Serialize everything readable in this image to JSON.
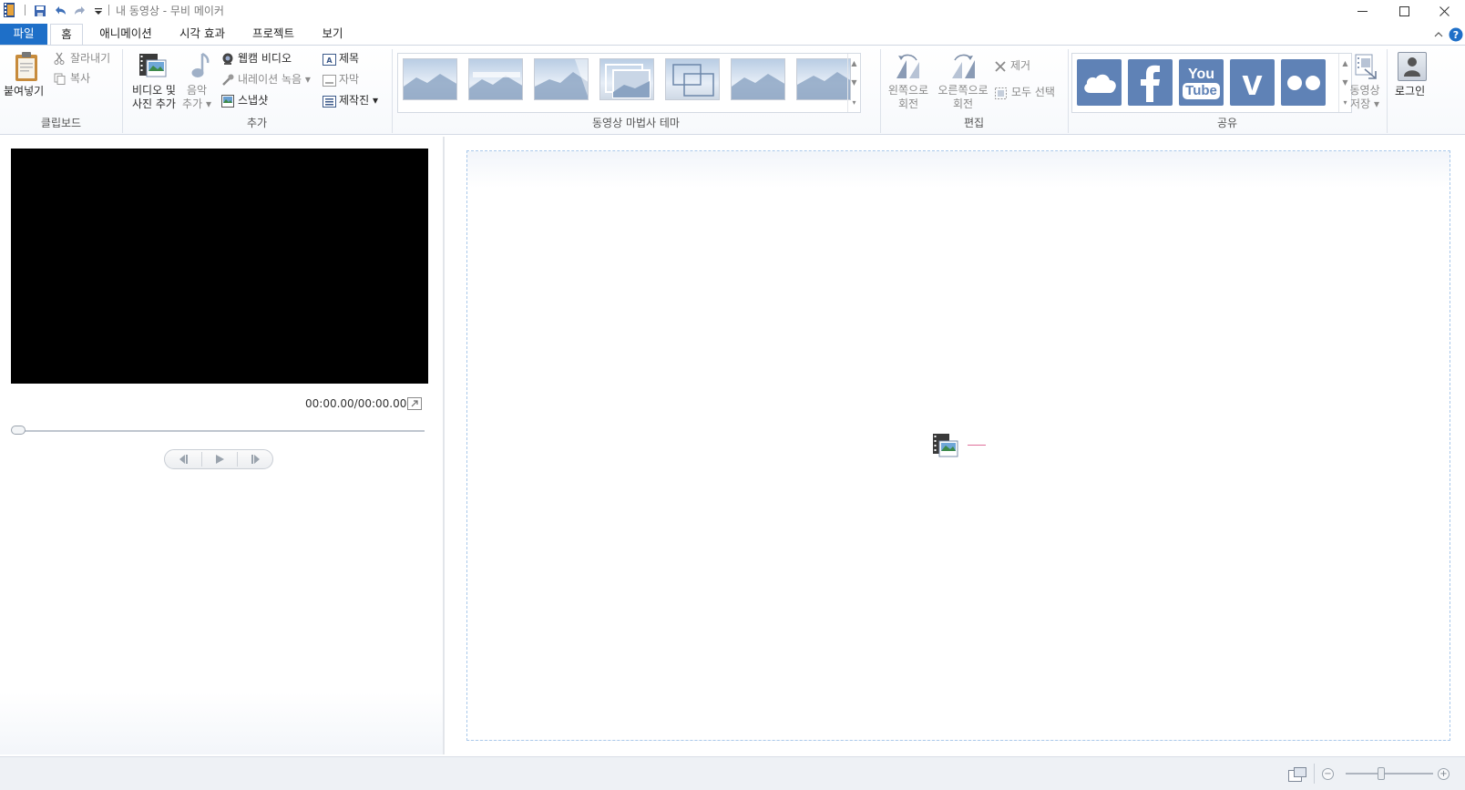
{
  "window": {
    "title": "내 동영상 - 무비 메이커"
  },
  "tabs": [
    {
      "label": "파일"
    },
    {
      "label": "홈"
    },
    {
      "label": "애니메이션"
    },
    {
      "label": "시각 효과"
    },
    {
      "label": "프로젝트"
    },
    {
      "label": "보기"
    }
  ],
  "ribbon": {
    "clipboard": {
      "paste": "붙여넣기",
      "cut": "잘라내기",
      "copy": "복사",
      "group": "클립보드"
    },
    "add": {
      "add_video_line1": "비디오 및",
      "add_video_line2": "사진 추가",
      "add_music_line1": "음악",
      "add_music_line2": "추가",
      "webcam": "웹캠 비디오",
      "narration": "내레이션 녹음",
      "snapshot": "스냅샷",
      "title": "제목",
      "caption": "자막",
      "credits": "제작진",
      "group": "추가"
    },
    "themes": {
      "group": "동영상 마법사 테마"
    },
    "edit": {
      "rotate_left_line1": "왼쪽으로",
      "rotate_left_line2": "회전",
      "rotate_right_line1": "오른쪽으로",
      "rotate_right_line2": "회전",
      "remove": "제거",
      "select_all": "모두 선택",
      "group": "편집"
    },
    "share": {
      "items": [
        {
          "icon": "onedrive-icon"
        },
        {
          "icon": "facebook-icon"
        },
        {
          "icon": "youtube-icon",
          "line1": "You",
          "line2": "Tube"
        },
        {
          "icon": "vimeo-icon",
          "text": "v"
        },
        {
          "icon": "flickr-icon"
        }
      ],
      "save_line1": "동영상",
      "save_line2": "저장",
      "group": "공유"
    },
    "signin": {
      "label": "로그인"
    }
  },
  "preview": {
    "time": "00:00.00/00:00.00"
  },
  "colors": {
    "accent": "#1e6fc8",
    "share_tile": "#5f82b6",
    "storyboard_border": "#a9c8ea"
  }
}
